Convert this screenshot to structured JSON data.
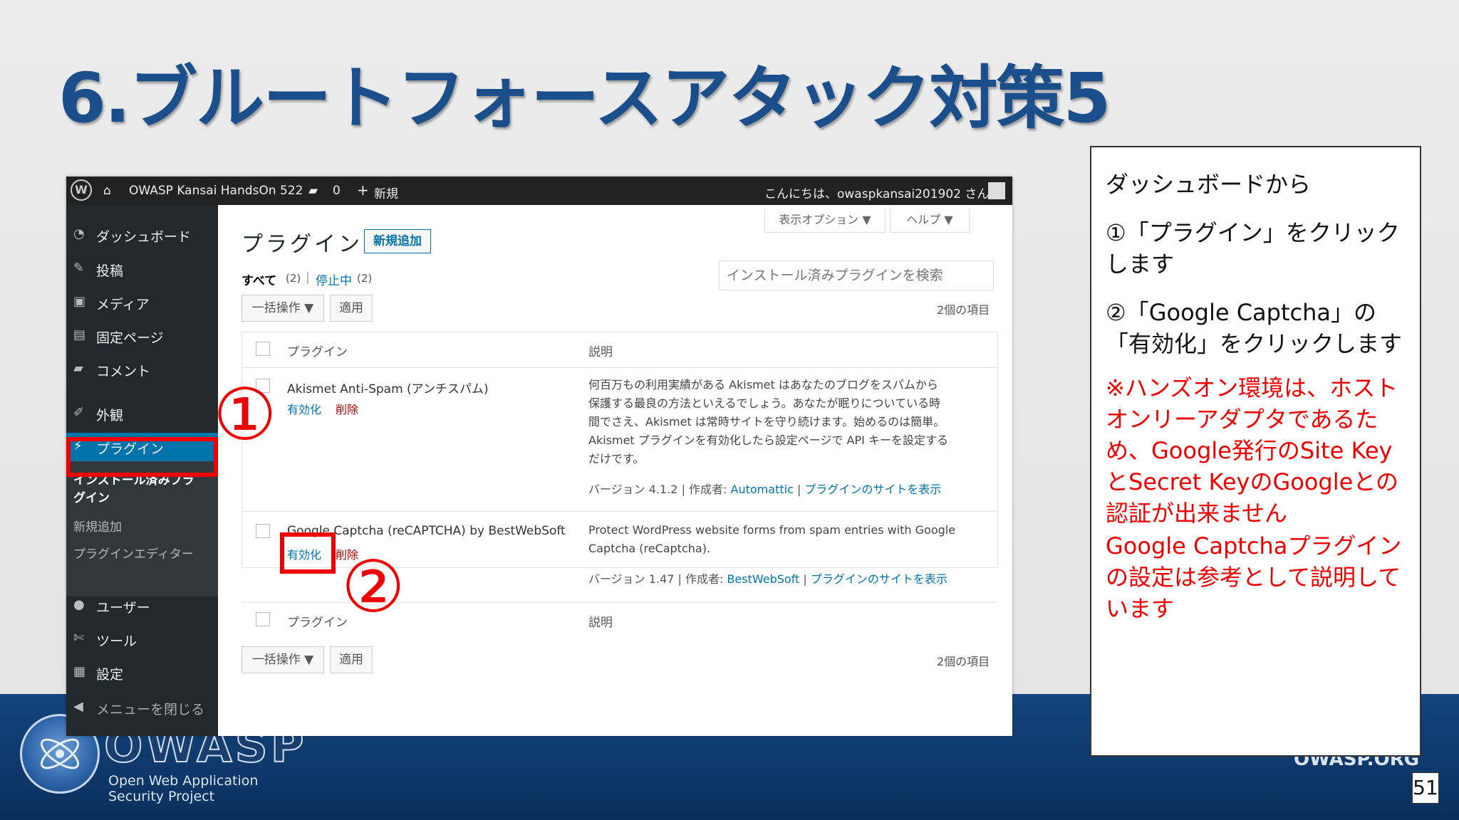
{
  "slide": {
    "title": "6.ブルートフォースアタック対策5",
    "page_number": "51",
    "owasp_word": "OWASP",
    "owasp_sub1": "Open Web Application",
    "owasp_sub2": "Security Project",
    "owasp_org": "OWASP.ORG"
  },
  "adminbar": {
    "site_name": "OWASP Kansai HandsOn 522",
    "comments_count": "0",
    "new_label": "新規",
    "greeting": "こんにちは、owaspkansai201902 さん"
  },
  "sidebar": {
    "items": [
      {
        "label": "ダッシュボード",
        "icon": "dashboard-icon"
      },
      {
        "label": "投稿",
        "icon": "pin-icon"
      },
      {
        "label": "メディア",
        "icon": "media-icon"
      },
      {
        "label": "固定ページ",
        "icon": "page-icon"
      },
      {
        "label": "コメント",
        "icon": "comment-icon"
      },
      {
        "label": "外観",
        "icon": "brush-icon"
      },
      {
        "label": "プラグイン",
        "icon": "plugin-icon"
      },
      {
        "label": "ユーザー",
        "icon": "user-icon"
      },
      {
        "label": "ツール",
        "icon": "wrench-icon"
      },
      {
        "label": "設定",
        "icon": "settings-icon"
      },
      {
        "label": "メニューを閉じる",
        "icon": "collapse-icon"
      }
    ],
    "submenu": [
      "インストール済みプラ",
      "グイン",
      "新規追加",
      "プラグインエディター"
    ]
  },
  "main": {
    "title": "プラグイン",
    "add_new": "新規追加",
    "screen_options": "表示オプション ▼",
    "help": "ヘルプ ▼",
    "filter_all": "すべて",
    "filter_all_count": "(2)",
    "filter_sep": "|",
    "filter_inactive": "停止中",
    "filter_inactive_count": "(2)",
    "search_placeholder": "インストール済みプラグインを検索",
    "bulk_action": "一括操作 ▼",
    "apply": "適用",
    "item_count": "2個の項目",
    "col_plugin": "プラグイン",
    "col_desc": "説明",
    "plugins": [
      {
        "name": "Akismet Anti-Spam (アンチスパム)",
        "activate": "有効化",
        "delete": "削除",
        "desc_lines": [
          "何百万もの利用実績がある Akismet はあなたのブログをスパムから",
          "保護する最良の方法といえるでしょう。あなたが眠りについている時",
          "間でさえ、Akismet は常時サイトを守り続けます。始めるのは簡単。",
          "Akismet プラグインを有効化したら設定ページで API キーを設定する",
          "だけです。"
        ],
        "version": "バージョン 4.1.2 | 作成者: ",
        "author": "Automattic",
        "site_link": "プラグインのサイトを表示"
      },
      {
        "name": "Google Captcha (reCAPTCHA) by BestWebSoft",
        "activate": "有効化",
        "delete": "削除",
        "desc_lines": [
          "Protect WordPress website forms from spam entries with Google",
          "Captcha (reCaptcha)."
        ],
        "version": "バージョン 1.47 | 作成者: ",
        "author": "BestWebSoft",
        "site_link": "プラグインのサイトを表示"
      }
    ]
  },
  "annotations": {
    "one": "①",
    "two": "②"
  },
  "note": {
    "line1": "ダッシュボードから",
    "line2": "①「プラグイン」をクリックします",
    "line3": "②「Google Captcha」の「有効化」をクリックします",
    "line4": "※ハンズオン環境は、ホストオンリーアダプタであるため、Google発行のSite KeyとSecret KeyのGoogleとの認証が出来ません",
    "line5": "Google Captchaプラグインの設定は参考として説明しています"
  },
  "colors": {
    "title": "#1b4f8c",
    "annotation_red": "#e00000",
    "wp_blue": "#0073aa",
    "footer": "#12457e"
  }
}
